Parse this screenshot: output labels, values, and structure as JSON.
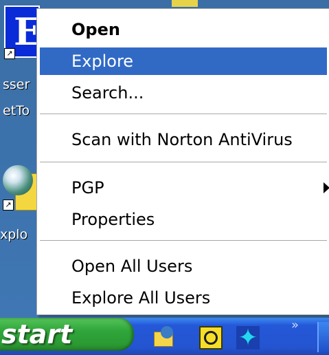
{
  "desktop": {
    "icon_top": {
      "letter": "E",
      "label_line1": "sser",
      "label_line2": "etTo"
    },
    "icon_globe": {
      "label": "xplo"
    },
    "shortcut_arrow": "↗"
  },
  "context_menu": {
    "items": [
      {
        "label": "Open",
        "bold": true,
        "selected": false
      },
      {
        "label": "Explore",
        "bold": false,
        "selected": true
      },
      {
        "label": "Search...",
        "bold": false,
        "selected": false
      },
      {
        "label": "Scan with Norton AntiVirus",
        "bold": false,
        "selected": false
      },
      {
        "label": "PGP",
        "bold": false,
        "selected": false,
        "has_submenu": true
      },
      {
        "label": "Properties",
        "bold": false,
        "selected": false
      },
      {
        "label": "Open All Users",
        "bold": false,
        "selected": false
      },
      {
        "label": "Explore All Users",
        "bold": false,
        "selected": false
      }
    ]
  },
  "taskbar": {
    "start_label": "start",
    "quick_launch": [
      "show-desktop-icon",
      "clock-icon",
      "star-icon"
    ],
    "overflow_glyph": "»"
  },
  "colors": {
    "selection": "#316ac5",
    "start_green": "#2fa53a",
    "taskbar_blue": "#2454d0",
    "desktop_blue": "#3a6ea5"
  }
}
